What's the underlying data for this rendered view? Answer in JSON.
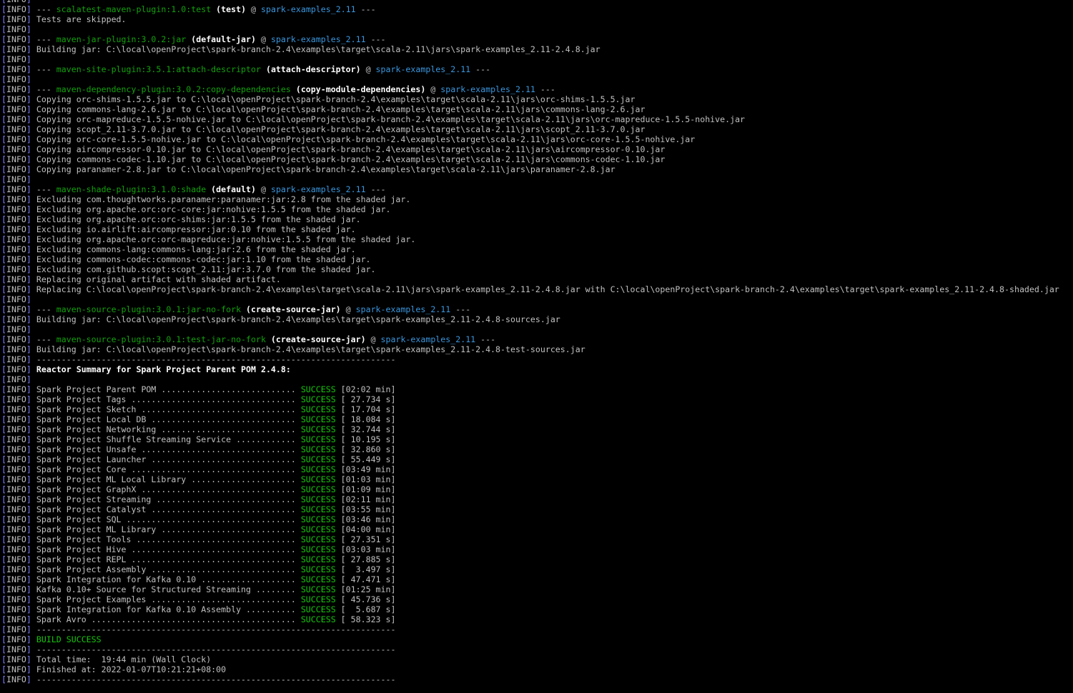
{
  "terminal": {
    "prefix": {
      "open": "[",
      "tag": "INFO",
      "close": "] "
    },
    "colors": {
      "background": "#000000",
      "text": "#c0c0c0",
      "bracket": "#8080ff",
      "plugin": "#13a10e",
      "artifact": "#3a96dd",
      "bold": "#ffffff",
      "success": "#16c60c"
    },
    "lines": [
      [],
      [
        [
          "plain",
          "--- "
        ],
        [
          "plugin",
          "scalatest-maven-plugin:1.0:test"
        ],
        [
          "bold",
          " (test)"
        ],
        [
          "plain",
          " @ "
        ],
        [
          "artifact",
          "spark-examples_2.11"
        ],
        [
          "plain",
          " ---"
        ]
      ],
      [
        [
          "plain",
          "Tests are skipped."
        ]
      ],
      [],
      [
        [
          "plain",
          "--- "
        ],
        [
          "plugin",
          "maven-jar-plugin:3.0.2:jar"
        ],
        [
          "bold",
          " (default-jar)"
        ],
        [
          "plain",
          " @ "
        ],
        [
          "artifact",
          "spark-examples_2.11"
        ],
        [
          "plain",
          " ---"
        ]
      ],
      [
        [
          "plain",
          "Building jar: C:\\local\\openProject\\spark-branch-2.4\\examples\\target\\scala-2.11\\jars\\spark-examples_2.11-2.4.8.jar"
        ]
      ],
      [],
      [
        [
          "plain",
          "--- "
        ],
        [
          "plugin",
          "maven-site-plugin:3.5.1:attach-descriptor"
        ],
        [
          "bold",
          " (attach-descriptor)"
        ],
        [
          "plain",
          " @ "
        ],
        [
          "artifact",
          "spark-examples_2.11"
        ],
        [
          "plain",
          " ---"
        ]
      ],
      [],
      [
        [
          "plain",
          "--- "
        ],
        [
          "plugin",
          "maven-dependency-plugin:3.0.2:copy-dependencies"
        ],
        [
          "bold",
          " (copy-module-dependencies)"
        ],
        [
          "plain",
          " @ "
        ],
        [
          "artifact",
          "spark-examples_2.11"
        ],
        [
          "plain",
          " ---"
        ]
      ],
      [
        [
          "plain",
          "Copying orc-shims-1.5.5.jar to C:\\local\\openProject\\spark-branch-2.4\\examples\\target\\scala-2.11\\jars\\orc-shims-1.5.5.jar"
        ]
      ],
      [
        [
          "plain",
          "Copying commons-lang-2.6.jar to C:\\local\\openProject\\spark-branch-2.4\\examples\\target\\scala-2.11\\jars\\commons-lang-2.6.jar"
        ]
      ],
      [
        [
          "plain",
          "Copying orc-mapreduce-1.5.5-nohive.jar to C:\\local\\openProject\\spark-branch-2.4\\examples\\target\\scala-2.11\\jars\\orc-mapreduce-1.5.5-nohive.jar"
        ]
      ],
      [
        [
          "plain",
          "Copying scopt_2.11-3.7.0.jar to C:\\local\\openProject\\spark-branch-2.4\\examples\\target\\scala-2.11\\jars\\scopt_2.11-3.7.0.jar"
        ]
      ],
      [
        [
          "plain",
          "Copying orc-core-1.5.5-nohive.jar to C:\\local\\openProject\\spark-branch-2.4\\examples\\target\\scala-2.11\\jars\\orc-core-1.5.5-nohive.jar"
        ]
      ],
      [
        [
          "plain",
          "Copying aircompressor-0.10.jar to C:\\local\\openProject\\spark-branch-2.4\\examples\\target\\scala-2.11\\jars\\aircompressor-0.10.jar"
        ]
      ],
      [
        [
          "plain",
          "Copying commons-codec-1.10.jar to C:\\local\\openProject\\spark-branch-2.4\\examples\\target\\scala-2.11\\jars\\commons-codec-1.10.jar"
        ]
      ],
      [
        [
          "plain",
          "Copying paranamer-2.8.jar to C:\\local\\openProject\\spark-branch-2.4\\examples\\target\\scala-2.11\\jars\\paranamer-2.8.jar"
        ]
      ],
      [],
      [
        [
          "plain",
          "--- "
        ],
        [
          "plugin",
          "maven-shade-plugin:3.1.0:shade"
        ],
        [
          "bold",
          " (default)"
        ],
        [
          "plain",
          " @ "
        ],
        [
          "artifact",
          "spark-examples_2.11"
        ],
        [
          "plain",
          " ---"
        ]
      ],
      [
        [
          "plain",
          "Excluding com.thoughtworks.paranamer:paranamer:jar:2.8 from the shaded jar."
        ]
      ],
      [
        [
          "plain",
          "Excluding org.apache.orc:orc-core:jar:nohive:1.5.5 from the shaded jar."
        ]
      ],
      [
        [
          "plain",
          "Excluding org.apache.orc:orc-shims:jar:1.5.5 from the shaded jar."
        ]
      ],
      [
        [
          "plain",
          "Excluding io.airlift:aircompressor:jar:0.10 from the shaded jar."
        ]
      ],
      [
        [
          "plain",
          "Excluding org.apache.orc:orc-mapreduce:jar:nohive:1.5.5 from the shaded jar."
        ]
      ],
      [
        [
          "plain",
          "Excluding commons-lang:commons-lang:jar:2.6 from the shaded jar."
        ]
      ],
      [
        [
          "plain",
          "Excluding commons-codec:commons-codec:jar:1.10 from the shaded jar."
        ]
      ],
      [
        [
          "plain",
          "Excluding com.github.scopt:scopt_2.11:jar:3.7.0 from the shaded jar."
        ]
      ],
      [
        [
          "plain",
          "Replacing original artifact with shaded artifact."
        ]
      ],
      [
        [
          "plain",
          "Replacing C:\\local\\openProject\\spark-branch-2.4\\examples\\target\\scala-2.11\\jars\\spark-examples_2.11-2.4.8.jar with C:\\local\\openProject\\spark-branch-2.4\\examples\\target\\spark-examples_2.11-2.4.8-shaded.jar"
        ]
      ],
      [],
      [
        [
          "plain",
          "--- "
        ],
        [
          "plugin",
          "maven-source-plugin:3.0.1:jar-no-fork"
        ],
        [
          "bold",
          " (create-source-jar)"
        ],
        [
          "plain",
          " @ "
        ],
        [
          "artifact",
          "spark-examples_2.11"
        ],
        [
          "plain",
          " ---"
        ]
      ],
      [
        [
          "plain",
          "Building jar: C:\\local\\openProject\\spark-branch-2.4\\examples\\target\\spark-examples_2.11-2.4.8-sources.jar"
        ]
      ],
      [],
      [
        [
          "plain",
          "--- "
        ],
        [
          "plugin",
          "maven-source-plugin:3.0.1:test-jar-no-fork"
        ],
        [
          "bold",
          " (create-source-jar)"
        ],
        [
          "plain",
          " @ "
        ],
        [
          "artifact",
          "spark-examples_2.11"
        ],
        [
          "plain",
          " ---"
        ]
      ],
      [
        [
          "plain",
          "Building jar: C:\\local\\openProject\\spark-branch-2.4\\examples\\target\\spark-examples_2.11-2.4.8-test-sources.jar"
        ]
      ],
      [
        [
          "plain",
          "------------------------------------------------------------------------"
        ]
      ],
      [
        [
          "bold",
          "Reactor Summary for Spark Project Parent POM 2.4.8:"
        ]
      ],
      [],
      [
        [
          "plain",
          "Spark Project Parent POM ........................... "
        ],
        [
          "success",
          "SUCCESS"
        ],
        [
          "plain",
          " [02:02 min]"
        ]
      ],
      [
        [
          "plain",
          "Spark Project Tags ................................. "
        ],
        [
          "success",
          "SUCCESS"
        ],
        [
          "plain",
          " [ 27.734 s]"
        ]
      ],
      [
        [
          "plain",
          "Spark Project Sketch ............................... "
        ],
        [
          "success",
          "SUCCESS"
        ],
        [
          "plain",
          " [ 17.704 s]"
        ]
      ],
      [
        [
          "plain",
          "Spark Project Local DB ............................. "
        ],
        [
          "success",
          "SUCCESS"
        ],
        [
          "plain",
          " [ 18.084 s]"
        ]
      ],
      [
        [
          "plain",
          "Spark Project Networking ........................... "
        ],
        [
          "success",
          "SUCCESS"
        ],
        [
          "plain",
          " [ 32.744 s]"
        ]
      ],
      [
        [
          "plain",
          "Spark Project Shuffle Streaming Service ............ "
        ],
        [
          "success",
          "SUCCESS"
        ],
        [
          "plain",
          " [ 10.195 s]"
        ]
      ],
      [
        [
          "plain",
          "Spark Project Unsafe ............................... "
        ],
        [
          "success",
          "SUCCESS"
        ],
        [
          "plain",
          " [ 32.860 s]"
        ]
      ],
      [
        [
          "plain",
          "Spark Project Launcher ............................. "
        ],
        [
          "success",
          "SUCCESS"
        ],
        [
          "plain",
          " [ 55.449 s]"
        ]
      ],
      [
        [
          "plain",
          "Spark Project Core ................................. "
        ],
        [
          "success",
          "SUCCESS"
        ],
        [
          "plain",
          " [03:49 min]"
        ]
      ],
      [
        [
          "plain",
          "Spark Project ML Local Library ..................... "
        ],
        [
          "success",
          "SUCCESS"
        ],
        [
          "plain",
          " [01:03 min]"
        ]
      ],
      [
        [
          "plain",
          "Spark Project GraphX ............................... "
        ],
        [
          "success",
          "SUCCESS"
        ],
        [
          "plain",
          " [01:09 min]"
        ]
      ],
      [
        [
          "plain",
          "Spark Project Streaming ............................ "
        ],
        [
          "success",
          "SUCCESS"
        ],
        [
          "plain",
          " [02:11 min]"
        ]
      ],
      [
        [
          "plain",
          "Spark Project Catalyst ............................. "
        ],
        [
          "success",
          "SUCCESS"
        ],
        [
          "plain",
          " [03:55 min]"
        ]
      ],
      [
        [
          "plain",
          "Spark Project SQL .................................. "
        ],
        [
          "success",
          "SUCCESS"
        ],
        [
          "plain",
          " [03:46 min]"
        ]
      ],
      [
        [
          "plain",
          "Spark Project ML Library ........................... "
        ],
        [
          "success",
          "SUCCESS"
        ],
        [
          "plain",
          " [04:00 min]"
        ]
      ],
      [
        [
          "plain",
          "Spark Project Tools ................................ "
        ],
        [
          "success",
          "SUCCESS"
        ],
        [
          "plain",
          " [ 27.351 s]"
        ]
      ],
      [
        [
          "plain",
          "Spark Project Hive ................................. "
        ],
        [
          "success",
          "SUCCESS"
        ],
        [
          "plain",
          " [03:03 min]"
        ]
      ],
      [
        [
          "plain",
          "Spark Project REPL ................................. "
        ],
        [
          "success",
          "SUCCESS"
        ],
        [
          "plain",
          " [ 27.885 s]"
        ]
      ],
      [
        [
          "plain",
          "Spark Project Assembly ............................. "
        ],
        [
          "success",
          "SUCCESS"
        ],
        [
          "plain",
          " [  3.497 s]"
        ]
      ],
      [
        [
          "plain",
          "Spark Integration for Kafka 0.10 ................... "
        ],
        [
          "success",
          "SUCCESS"
        ],
        [
          "plain",
          " [ 47.471 s]"
        ]
      ],
      [
        [
          "plain",
          "Kafka 0.10+ Source for Structured Streaming ........ "
        ],
        [
          "success",
          "SUCCESS"
        ],
        [
          "plain",
          " [01:25 min]"
        ]
      ],
      [
        [
          "plain",
          "Spark Project Examples ............................. "
        ],
        [
          "success",
          "SUCCESS"
        ],
        [
          "plain",
          " [ 45.736 s]"
        ]
      ],
      [
        [
          "plain",
          "Spark Integration for Kafka 0.10 Assembly .......... "
        ],
        [
          "success",
          "SUCCESS"
        ],
        [
          "plain",
          " [  5.687 s]"
        ]
      ],
      [
        [
          "plain",
          "Spark Avro ......................................... "
        ],
        [
          "success",
          "SUCCESS"
        ],
        [
          "plain",
          " [ 58.323 s]"
        ]
      ],
      [
        [
          "plain",
          "------------------------------------------------------------------------"
        ]
      ],
      [
        [
          "success",
          "BUILD SUCCESS"
        ]
      ],
      [
        [
          "plain",
          "------------------------------------------------------------------------"
        ]
      ],
      [
        [
          "plain",
          "Total time:  19:44 min (Wall Clock)"
        ]
      ],
      [
        [
          "plain",
          "Finished at: 2022-01-07T10:21:21+08:00"
        ]
      ],
      [
        [
          "plain",
          "------------------------------------------------------------------------"
        ]
      ]
    ]
  }
}
